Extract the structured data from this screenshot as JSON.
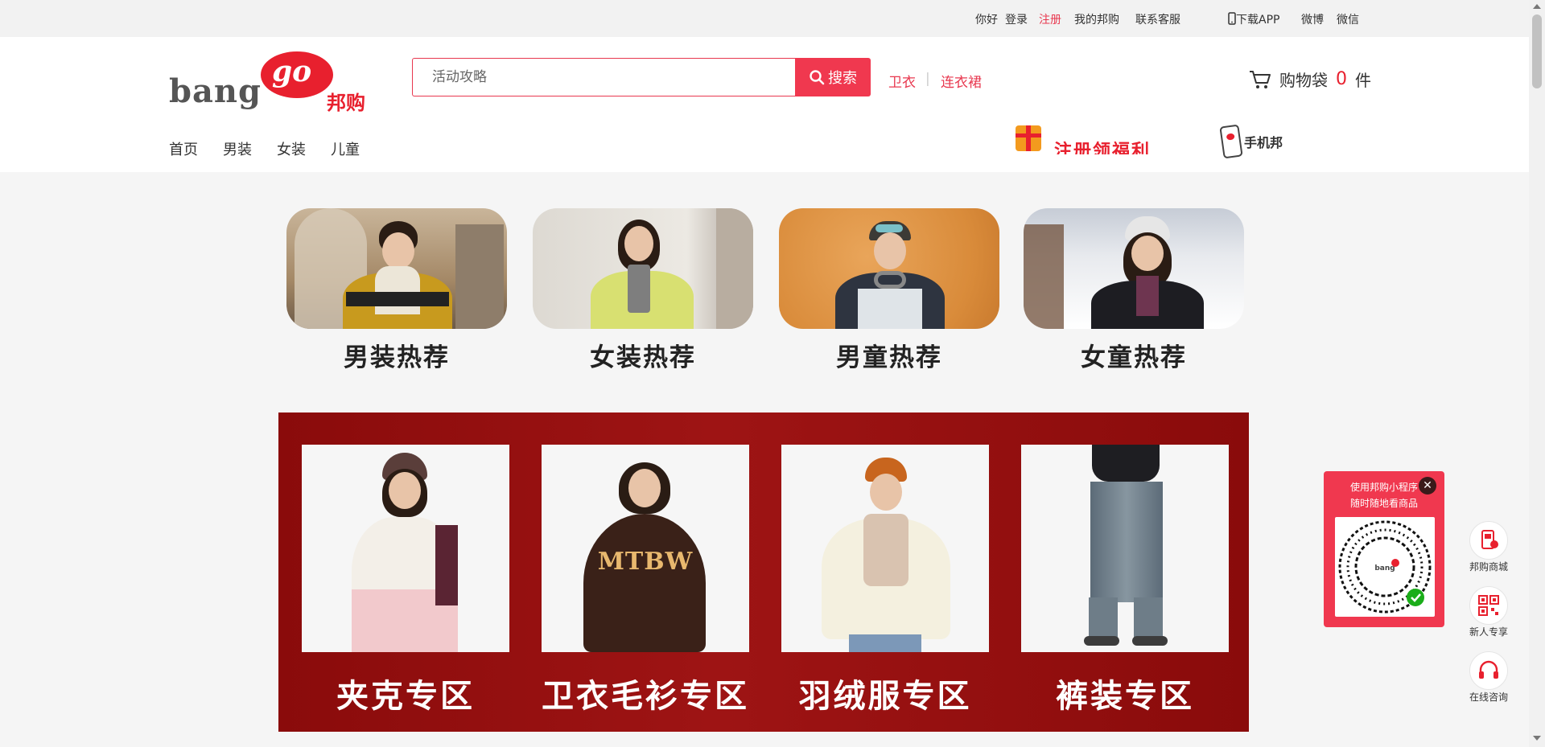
{
  "topbar": {
    "greeting": "你好",
    "login": "登录",
    "register": "注册",
    "my_account": "我的邦购",
    "service": "联系客服",
    "download_app": "下载APP",
    "weibo": "微博",
    "weixin": "微信"
  },
  "logo": {
    "latin": "bang",
    "go": "go",
    "chinese": "邦购"
  },
  "search": {
    "placeholder": "活动攻略",
    "button": "搜索"
  },
  "hotwords": [
    "卫衣",
    "连衣裙"
  ],
  "hot_separator": "|",
  "cart": {
    "label": "购物袋",
    "count": "0",
    "unit": "件"
  },
  "nav": [
    "首页",
    "男装",
    "女装",
    "儿童"
  ],
  "promo": {
    "text": "注册领福利"
  },
  "mobile": {
    "label": "手机邦"
  },
  "categories": [
    {
      "label": "男装热荐"
    },
    {
      "label": "女装热荐"
    },
    {
      "label": "男童热荐"
    },
    {
      "label": "女童热荐"
    }
  ],
  "zones": [
    {
      "label": "夹克专区"
    },
    {
      "label": "卫衣毛衫专区",
      "print": "MTBW"
    },
    {
      "label": "羽绒服专区"
    },
    {
      "label": "裤装专区"
    }
  ],
  "mini_program": {
    "line1": "使用邦购小程序",
    "line2": "随时随地看商品",
    "close": "✕"
  },
  "side_tools": [
    {
      "label": "邦购商城",
      "icon": "phone-shop-icon"
    },
    {
      "label": "新人专享",
      "icon": "qr-code-icon"
    },
    {
      "label": "在线咨询",
      "icon": "headset-icon"
    }
  ],
  "colors": {
    "accent": "#f0384f",
    "brand_red": "#e8202e",
    "banner_red": "#8a0b0b"
  }
}
